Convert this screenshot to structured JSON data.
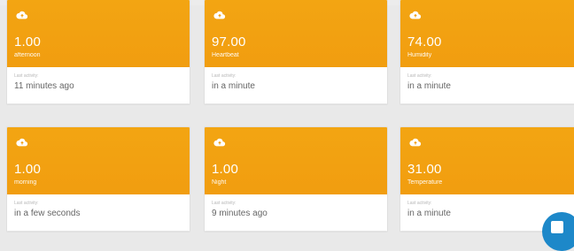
{
  "cards": [
    {
      "value": "1.00",
      "name": "afternoon",
      "last_activity_label": "Last activity:",
      "last_activity": "11 minutes ago"
    },
    {
      "value": "97.00",
      "name": "Heartbeat",
      "last_activity_label": "Last activity:",
      "last_activity": "in a minute"
    },
    {
      "value": "74.00",
      "name": "Humidity",
      "last_activity_label": "Last activity:",
      "last_activity": "in a minute"
    },
    {
      "value": "1.00",
      "name": "morning",
      "last_activity_label": "Last activity:",
      "last_activity": "in a few seconds"
    },
    {
      "value": "1.00",
      "name": "Night",
      "last_activity_label": "Last activity:",
      "last_activity": "9 minutes ago"
    },
    {
      "value": "31.00",
      "name": "Temperature",
      "last_activity_label": "Last activity:",
      "last_activity": "in a minute"
    }
  ],
  "icons": {
    "card_icon": "cloud-upload-icon",
    "chat_icon": "chat-icon"
  },
  "colors": {
    "card_header": "#f29f10",
    "chat_button": "#1d88c9"
  }
}
